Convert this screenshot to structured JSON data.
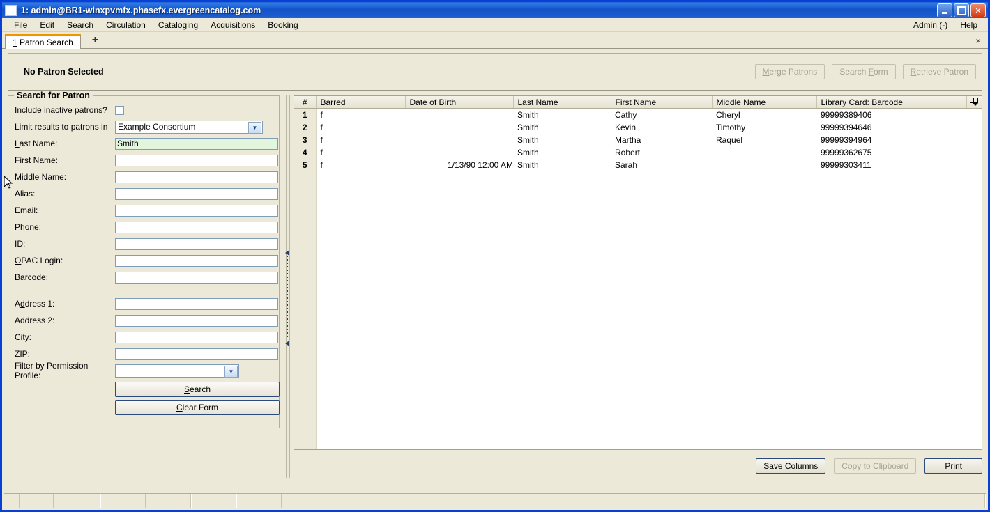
{
  "window": {
    "title": "1: admin@BR1-winxpvmfx.phasefx.evergreencatalog.com",
    "minimize": "minimize-button",
    "maximize": "maximize-button",
    "close": "✕"
  },
  "menu": {
    "items": [
      {
        "label": "File",
        "accel": "F"
      },
      {
        "label": "Edit",
        "accel": "E"
      },
      {
        "label": "Search",
        "accel": "c"
      },
      {
        "label": "Circulation",
        "accel": "C"
      },
      {
        "label": "Cataloging",
        "accel": "g"
      },
      {
        "label": "Acquisitions",
        "accel": "A"
      },
      {
        "label": "Booking",
        "accel": "B"
      }
    ],
    "right": [
      {
        "label": "Admin (-)",
        "accel": ""
      },
      {
        "label": "Help",
        "accel": "H"
      }
    ]
  },
  "tabs": {
    "active": "1 Patron Search",
    "active_number": "1",
    "active_label": "Patron Search",
    "new_tab": "+",
    "close_tab": "×"
  },
  "patron_bar": {
    "status": "No Patron Selected",
    "buttons": [
      {
        "label": "Merge Patrons",
        "enabled": false
      },
      {
        "label": "Search Form",
        "enabled": false
      },
      {
        "label": "Retrieve Patron",
        "enabled": false
      }
    ]
  },
  "search_form": {
    "legend": "Search for Patron",
    "include_inactive_label": "Include inactive patrons?",
    "include_inactive_checked": false,
    "limit_label": "Limit results to patrons in",
    "limit_value": "Example Consortium",
    "fields": [
      {
        "label": "Last Name:",
        "value": "Smith",
        "active": true
      },
      {
        "label": "First Name:",
        "value": "",
        "active": false
      },
      {
        "label": "Middle Name:",
        "value": "",
        "active": false
      },
      {
        "label": "Alias:",
        "value": "",
        "active": false
      },
      {
        "label": "Email:",
        "value": "",
        "active": false
      },
      {
        "label": "Phone:",
        "value": "",
        "active": false
      },
      {
        "label": "ID:",
        "value": "",
        "active": false
      },
      {
        "label": "OPAC Login:",
        "value": "",
        "active": false
      },
      {
        "label": "Barcode:",
        "value": "",
        "active": false
      }
    ],
    "address_fields": [
      {
        "label": "Address 1:",
        "value": ""
      },
      {
        "label": "Address 2:",
        "value": ""
      },
      {
        "label": "City:",
        "value": ""
      },
      {
        "label": "ZIP:",
        "value": ""
      }
    ],
    "permission_label": "Filter by Permission Profile:",
    "permission_value": "",
    "search_button": "Search",
    "clear_button": "Clear Form"
  },
  "results": {
    "columns": [
      "#",
      "Barred",
      "Date of Birth",
      "Last Name",
      "First Name",
      "Middle Name",
      "Library Card: Barcode"
    ],
    "column_picker_icon": "column-picker-icon",
    "rows": [
      {
        "num": "1",
        "barred": "f",
        "dob": "",
        "last": "Smith",
        "first": "Cathy",
        "middle": "Cheryl",
        "barcode": "99999389406"
      },
      {
        "num": "2",
        "barred": "f",
        "dob": "",
        "last": "Smith",
        "first": "Kevin",
        "middle": "Timothy",
        "barcode": "99999394646"
      },
      {
        "num": "3",
        "barred": "f",
        "dob": "",
        "last": "Smith",
        "first": "Martha",
        "middle": "Raquel",
        "barcode": "99999394964"
      },
      {
        "num": "4",
        "barred": "f",
        "dob": "",
        "last": "Smith",
        "first": "Robert",
        "middle": "",
        "barcode": "99999362675"
      },
      {
        "num": "5",
        "barred": "f",
        "dob": "1/13/90 12:00 AM",
        "last": "Smith",
        "first": "Sarah",
        "middle": "",
        "barcode": "99999303411"
      }
    ],
    "footer_buttons": [
      {
        "label": "Save Columns",
        "enabled": true
      },
      {
        "label": "Copy to Clipboard",
        "enabled": false
      },
      {
        "label": "Print",
        "enabled": true
      }
    ]
  },
  "colors": {
    "title_blue": "#1254c8",
    "chrome": "#ece9d8",
    "active_field": "#e2f5dd",
    "tab_accent": "#f29400"
  }
}
